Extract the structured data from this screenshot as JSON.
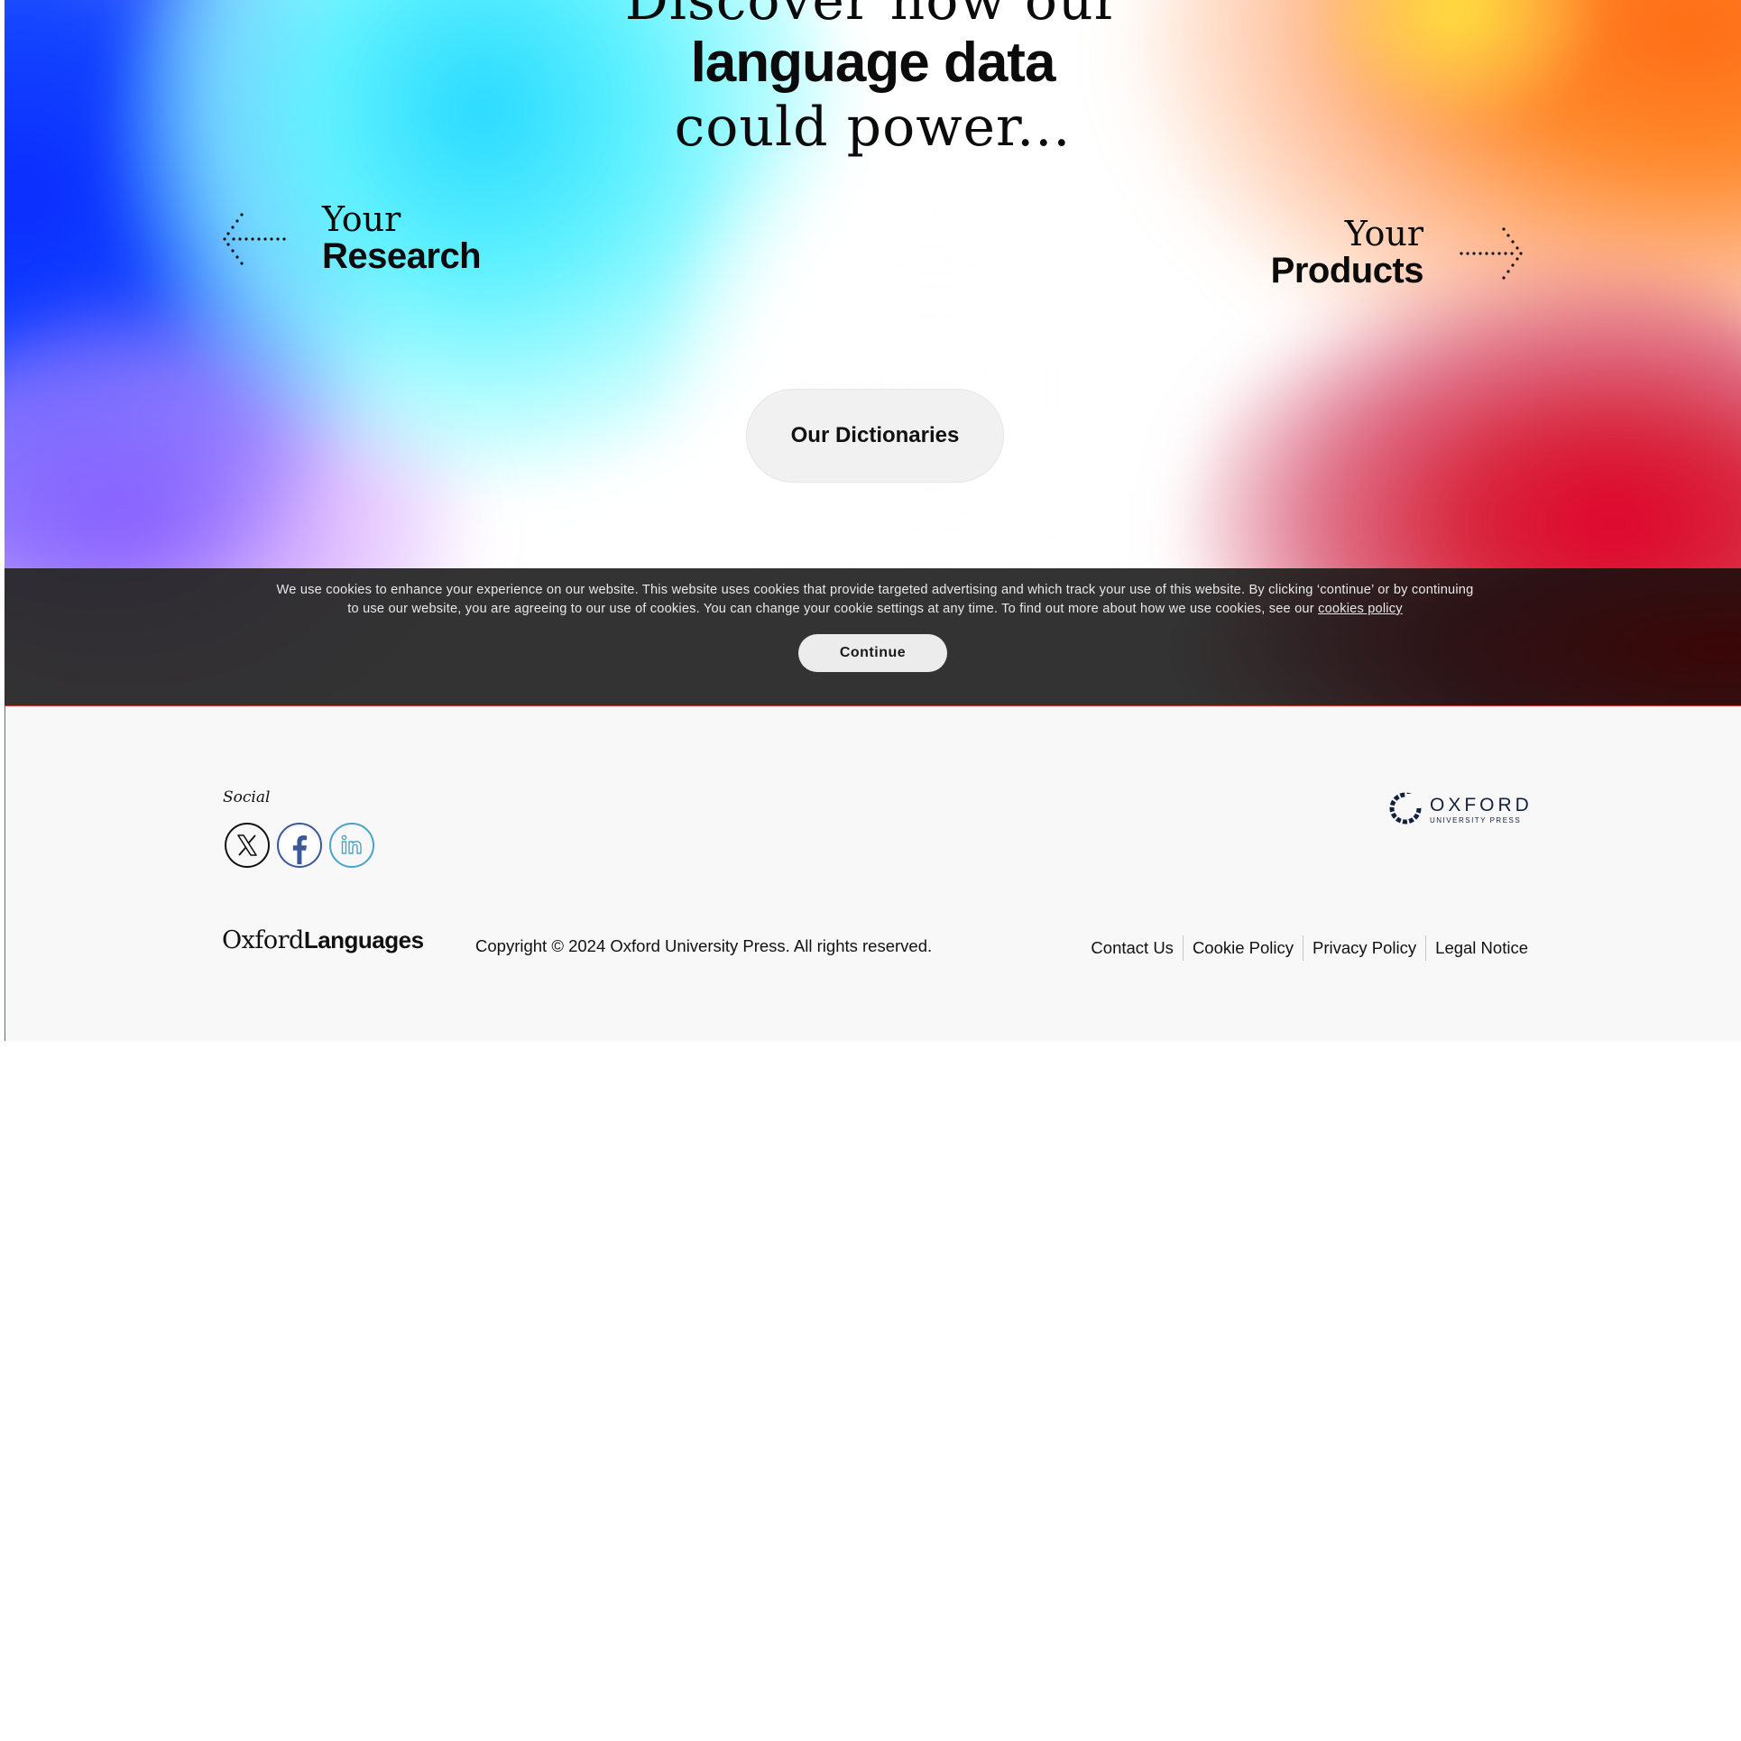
{
  "hero": {
    "line1": "Discover how our",
    "line2": "language data",
    "line3": "could power...",
    "left_link": {
      "prefix": "Your",
      "label": "Research"
    },
    "right_link": {
      "prefix": "Your",
      "label": "Products"
    },
    "dictionaries_button": "Our Dictionaries"
  },
  "cookie_banner": {
    "text": "We use cookies to enhance your experience on our website. This website uses cookies that provide targeted advertising and which track your use of this website. By clicking ‘continue’ or by continuing to use our website, you are agreeing to our use of cookies. You can change your cookie settings at any time. To find out more about how we use cookies, see our",
    "link": "cookies policy",
    "button": "Continue"
  },
  "footer": {
    "social_label": "Social",
    "social_icons": [
      "x-icon",
      "facebook-icon",
      "linkedin-icon"
    ],
    "oup_logo": {
      "title": "OXFORD",
      "subtitle": "UNIVERSITY PRESS"
    },
    "brand": {
      "part1": "Oxford",
      "part2": "Languages"
    },
    "copyright": "Copyright © 2024 Oxford University Press. All rights reserved.",
    "links": [
      "Contact Us",
      "Cookie Policy",
      "Privacy Policy",
      "Legal Notice"
    ]
  },
  "colors": {
    "banner_bg": "#2b2b2b",
    "footer_bg": "#f8f8f8",
    "oup_navy": "#14213d",
    "facebook_blue": "#3b5998",
    "linkedin_blue": "#4aa3c8"
  }
}
